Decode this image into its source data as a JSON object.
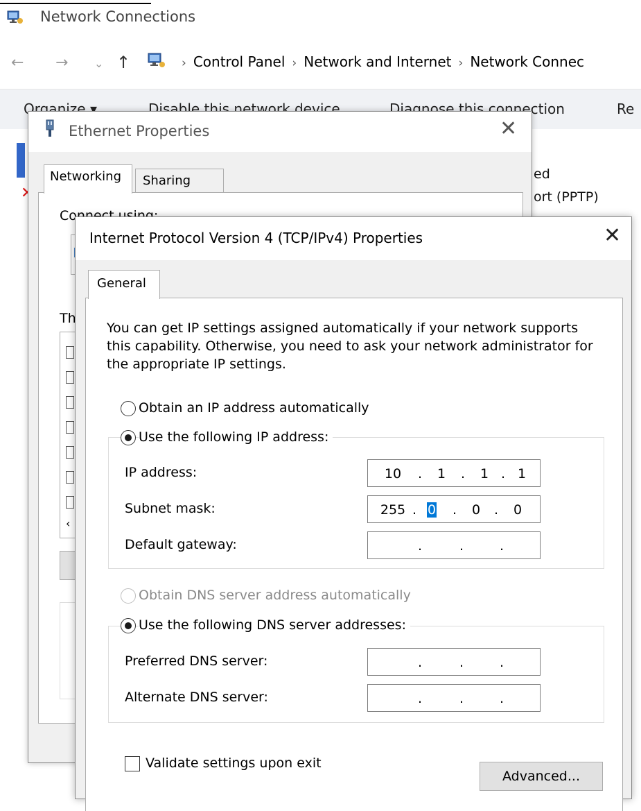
{
  "explorer": {
    "title": "Network Connections",
    "breadcrumbs": [
      "Control Panel",
      "Network and Internet",
      "Network Connec"
    ],
    "ribbon": [
      "Organize ▾",
      "Disable this network device",
      "Diagnose this connection",
      "Re"
    ],
    "bg_labels": [
      "ed",
      "ort (PPTP)"
    ]
  },
  "ethernet_dialog": {
    "title": "Ethernet Properties",
    "tabs": [
      "Networking",
      "Sharing"
    ],
    "connect_label": "Connect using:",
    "components_label": "Th"
  },
  "ipv4_dialog": {
    "title": "Internet Protocol Version 4 (TCP/IPv4) Properties",
    "tab": "General",
    "description": "You can get IP settings assigned automatically if your network supports this capability. Otherwise, you need to ask your network administrator for the appropriate IP settings.",
    "ip_mode": {
      "auto_label": "Obtain an IP address automatically",
      "manual_label": "Use the following IP address:",
      "selected": "manual"
    },
    "fields": {
      "ip_address": {
        "label": "IP address:",
        "octets": [
          "10",
          "1",
          "1",
          "1"
        ]
      },
      "subnet_mask": {
        "label": "Subnet mask:",
        "octets": [
          "255",
          "0",
          "0",
          "0"
        ]
      },
      "default_gateway": {
        "label": "Default gateway:",
        "octets": [
          "",
          "",
          "",
          ""
        ]
      }
    },
    "dns_mode": {
      "auto_label": "Obtain DNS server address automatically",
      "manual_label": "Use the following DNS server addresses:",
      "selected": "manual"
    },
    "dns_fields": {
      "preferred": {
        "label": "Preferred DNS server:",
        "octets": [
          "",
          "",
          "",
          ""
        ]
      },
      "alternate": {
        "label": "Alternate DNS server:",
        "octets": [
          "",
          "",
          "",
          ""
        ]
      }
    },
    "validate_label": "Validate settings upon exit",
    "validate_checked": false,
    "advanced_label": "Advanced..."
  }
}
